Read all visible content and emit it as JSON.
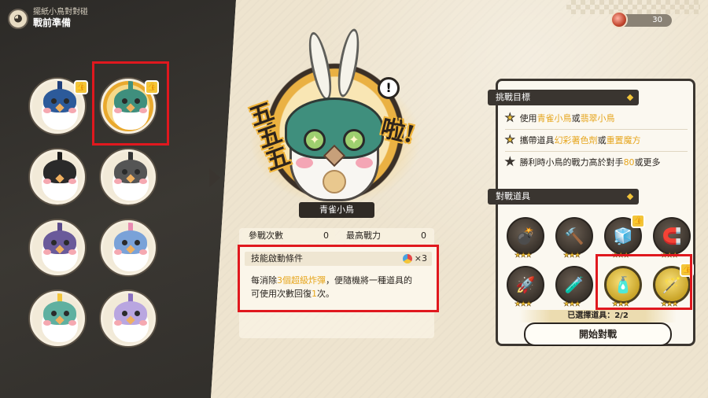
{
  "header": {
    "subtitle": "擺紙小鳥對對碰",
    "title": "戰前準備"
  },
  "currency": {
    "value": "30"
  },
  "birds": [
    {
      "color": "#2c5a9a",
      "crest": "#1e3e7a",
      "thumb": true
    },
    {
      "color": "#3f8f7d",
      "crest": "#3f8f7d",
      "thumb": true,
      "selected": true
    },
    {
      "color": "#2a2a2a",
      "crest": "#1a1a1a",
      "thumb": false
    },
    {
      "color": "#555555",
      "crest": "#333333",
      "thumb": false
    },
    {
      "color": "#6a5a9a",
      "crest": "#5a4a8a",
      "thumb": false
    },
    {
      "color": "#7aa2d8",
      "crest": "#e88ab0",
      "thumb": false
    },
    {
      "color": "#5fb0a0",
      "crest": "#f3c53a",
      "thumb": false
    },
    {
      "color": "#b9a6e0",
      "crest": "#8a70c0",
      "thumb": false
    }
  ],
  "hero": {
    "name": "青雀小鳥",
    "sfx_left": "五五五",
    "sfx_right": "啦!",
    "exclaim": "!"
  },
  "stats": {
    "battles_label": "參戰次數",
    "battles_value": "0",
    "power_label": "最高戰力",
    "power_value": "0"
  },
  "skill": {
    "title": "技能啟動條件",
    "cost": "×3",
    "line1_a": "每消除",
    "line1_hl": "3個超級炸彈",
    "line1_b": "，便隨機將一種道具的",
    "line2_a": "可使用次數回復",
    "line2_hl": "1",
    "line2_b": "次。"
  },
  "goals": {
    "title": "挑戰目標",
    "g1_a": "使用",
    "g1_h1": "青雀小鳥",
    "g1_b": "或",
    "g1_h2": "翡翠小鳥",
    "g2_a": "攜帶道具",
    "g2_h1": "幻彩著色劑",
    "g2_b": "或",
    "g2_h2": "重置魔方",
    "g3_a": "勝利時小鳥的戰力高於對手",
    "g3_h1": "80",
    "g3_b": "或更多"
  },
  "items": {
    "title": "對戰道具",
    "list": [
      {
        "icon": "💣",
        "stars": "★★★",
        "gold": false
      },
      {
        "icon": "🔨",
        "stars": "★★★",
        "gold": false
      },
      {
        "icon": "🧊",
        "stars": "★★★",
        "gold": false,
        "thumb": true
      },
      {
        "icon": "🧲",
        "stars": "★★★",
        "gold": false
      },
      {
        "icon": "🚀",
        "stars": "★★★",
        "gold": false
      },
      {
        "icon": "🧪",
        "stars": "★★★",
        "gold": false
      },
      {
        "icon": "🧴",
        "stars": "★★★",
        "gold": true
      },
      {
        "icon": "🪄",
        "stars": "★★★",
        "gold": true,
        "thumb": true
      }
    ],
    "chosen": "已選擇道具：2/2"
  },
  "start_button": "開始對戰"
}
